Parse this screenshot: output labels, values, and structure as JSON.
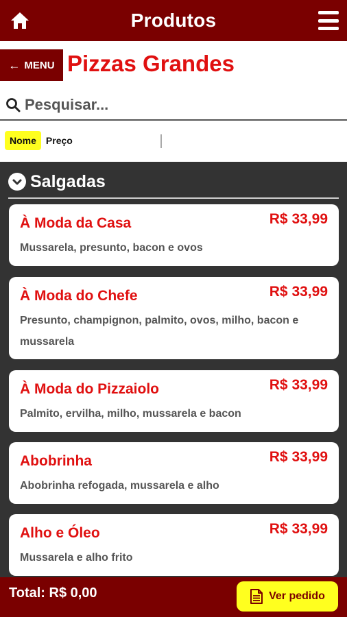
{
  "header": {
    "title": "Produtos",
    "home_icon": "home-icon",
    "menu_icon": "hamburger-menu-icon"
  },
  "nav": {
    "back_label": "MENU",
    "category_title": "Pizzas Grandes"
  },
  "search": {
    "placeholder": "Pesquisar..."
  },
  "sort": {
    "options": [
      "Nome",
      "Preço"
    ],
    "selected": "Nome"
  },
  "section": {
    "title": "Salgadas"
  },
  "products": [
    {
      "name": "À Moda da Casa",
      "price": "R$ 33,99",
      "description": "Mussarela, presunto, bacon e ovos"
    },
    {
      "name": "À Moda do Chefe",
      "price": "R$ 33,99",
      "description": "Presunto, champignon, palmito, ovos, milho, bacon e mussarela"
    },
    {
      "name": "À Moda do Pizzaiolo",
      "price": "R$ 33,99",
      "description": "Palmito, ervilha, milho, mussarela e bacon"
    },
    {
      "name": "Abobrinha",
      "price": "R$ 33,99",
      "description": "Abobrinha refogada, mussarela e alho"
    },
    {
      "name": "Alho e Óleo",
      "price": "R$ 33,99",
      "description": "Mussarela e alho frito"
    }
  ],
  "footer": {
    "total": "Total: R$ 0,00",
    "order_button": "Ver pedido"
  },
  "colors": {
    "brand": "#7a0000",
    "accent_red": "#e01010",
    "highlight": "#ffff1f",
    "list_bg": "#333333"
  }
}
